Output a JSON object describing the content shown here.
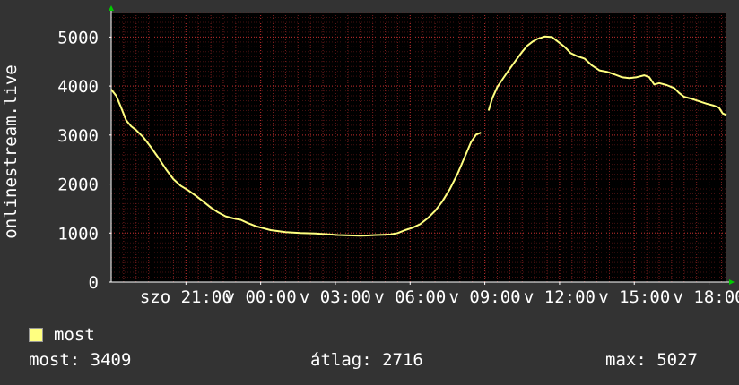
{
  "chart_data": {
    "type": "line",
    "ylabel": "onlinestream.live",
    "ylim": [
      0,
      5500
    ],
    "yticks": [
      0,
      1000,
      2000,
      3000,
      4000,
      5000
    ],
    "x_tick_labels": [
      "szo 21:00",
      "v 00:00",
      "v 03:00",
      "v 06:00",
      "v 09:00",
      "v 12:00",
      "v 15:00",
      "v 18:00"
    ],
    "x_tick_hours": [
      3,
      6,
      9,
      12,
      15,
      18,
      21,
      24
    ],
    "x_range_hours": [
      0,
      24.7
    ],
    "grid": true,
    "series": [
      {
        "name": "most",
        "color": "#ffff80",
        "points": [
          [
            0.0,
            3930
          ],
          [
            0.2,
            3800
          ],
          [
            0.4,
            3560
          ],
          [
            0.6,
            3300
          ],
          [
            0.8,
            3180
          ],
          [
            1.0,
            3100
          ],
          [
            1.3,
            2950
          ],
          [
            1.6,
            2750
          ],
          [
            1.9,
            2530
          ],
          [
            2.2,
            2300
          ],
          [
            2.5,
            2100
          ],
          [
            2.8,
            1960
          ],
          [
            3.1,
            1870
          ],
          [
            3.4,
            1760
          ],
          [
            3.7,
            1640
          ],
          [
            4.0,
            1520
          ],
          [
            4.3,
            1420
          ],
          [
            4.6,
            1340
          ],
          [
            4.9,
            1300
          ],
          [
            5.2,
            1270
          ],
          [
            5.5,
            1200
          ],
          [
            5.8,
            1140
          ],
          [
            6.1,
            1100
          ],
          [
            6.4,
            1060
          ],
          [
            6.7,
            1040
          ],
          [
            7.0,
            1020
          ],
          [
            7.3,
            1010
          ],
          [
            7.6,
            1000
          ],
          [
            7.9,
            995
          ],
          [
            8.2,
            990
          ],
          [
            8.5,
            980
          ],
          [
            8.8,
            970
          ],
          [
            9.1,
            960
          ],
          [
            9.4,
            955
          ],
          [
            9.7,
            950
          ],
          [
            10.0,
            945
          ],
          [
            10.3,
            950
          ],
          [
            10.6,
            960
          ],
          [
            10.9,
            965
          ],
          [
            11.2,
            970
          ],
          [
            11.5,
            1000
          ],
          [
            11.8,
            1060
          ],
          [
            12.1,
            1110
          ],
          [
            12.4,
            1180
          ],
          [
            12.7,
            1300
          ],
          [
            13.0,
            1450
          ],
          [
            13.3,
            1650
          ],
          [
            13.6,
            1900
          ],
          [
            13.9,
            2200
          ],
          [
            14.2,
            2560
          ],
          [
            14.45,
            2860
          ],
          [
            14.65,
            3010
          ],
          [
            14.85,
            3050
          ],
          null,
          [
            15.15,
            3500
          ],
          [
            15.3,
            3750
          ],
          [
            15.5,
            3980
          ],
          [
            15.7,
            4130
          ],
          [
            15.9,
            4280
          ],
          [
            16.1,
            4420
          ],
          [
            16.3,
            4560
          ],
          [
            16.5,
            4700
          ],
          [
            16.7,
            4820
          ],
          [
            16.9,
            4900
          ],
          [
            17.1,
            4960
          ],
          [
            17.4,
            5010
          ],
          [
            17.7,
            5000
          ],
          [
            17.95,
            4900
          ],
          [
            18.2,
            4800
          ],
          [
            18.45,
            4670
          ],
          [
            18.7,
            4610
          ],
          [
            19.0,
            4560
          ],
          [
            19.3,
            4420
          ],
          [
            19.6,
            4320
          ],
          [
            19.9,
            4290
          ],
          [
            20.2,
            4240
          ],
          [
            20.5,
            4180
          ],
          [
            20.8,
            4160
          ],
          [
            21.1,
            4180
          ],
          [
            21.4,
            4220
          ],
          [
            21.6,
            4180
          ],
          [
            21.8,
            4030
          ],
          [
            22.0,
            4060
          ],
          [
            22.3,
            4020
          ],
          [
            22.6,
            3960
          ],
          [
            22.8,
            3860
          ],
          [
            23.0,
            3780
          ],
          [
            23.3,
            3740
          ],
          [
            23.6,
            3690
          ],
          [
            23.9,
            3640
          ],
          [
            24.2,
            3600
          ],
          [
            24.4,
            3560
          ],
          [
            24.55,
            3440
          ],
          [
            24.7,
            3409
          ]
        ]
      }
    ]
  },
  "legend": {
    "label": "most",
    "color": "#ffff80"
  },
  "stats": {
    "current": "most: 3409",
    "average": "átlag: 2716",
    "maximum": "max: 5027"
  },
  "colors": {
    "background": "#333333",
    "plot_background": "#000000",
    "grid": "#7a1e1e",
    "text": "#ffffff",
    "axis_arrow": "#00cc00"
  }
}
